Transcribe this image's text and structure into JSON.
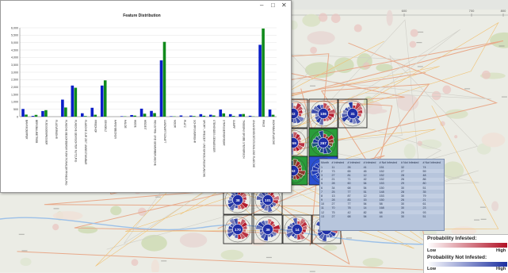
{
  "window": {
    "minimize": "–",
    "maximize": "□",
    "close": "✕"
  },
  "chart_data": {
    "type": "bar",
    "title": "Feature Distribution",
    "ylim": [
      0,
      6000
    ],
    "yticks": [
      "0",
      "500",
      "1,000",
      "1,500",
      "2,000",
      "2,500",
      "3,000",
      "3,500",
      "4,000",
      "4,500",
      "5,000",
      "5,500",
      "6,000"
    ],
    "categories": [
      "BAHNKOERPER",
      "BERGBAUBETRIEB",
      "FLIESSGEWAESSER",
      "FLUGVERKEHR",
      "FLAECHE BESONDERER FUNKTIONALER PRAEGUNG",
      "FLAECHE GEMISCHTER NUTZUNG",
      "FLAECHE ZUR ZEIT UNBESTIMMBAR",
      "FRIEDHOF",
      "GEHOELZ",
      "HAFENBECKEN",
      "HALDE",
      "HEIDE",
      "HEIDEIT",
      "INDUSTRIE- UND GEWERBEFLAECHE",
      "LANDWIRTSCHAFT",
      "MOOR",
      "PLATZ",
      "SCHIFFSVERKEHR",
      "SPORT-, FREIZEIT- UND ERHOLUNGSFLAECHE",
      "STEHENDES GEWAESSER",
      "STRASSENVERKEHR",
      "SUMPF",
      "TAGEBAU GRUBE STEINBRUCH",
      "UNLAND/VEGETATIONSLOSE FLAECHE",
      "WALD",
      "WOHNBAUFLAECHE"
    ],
    "series": [
      {
        "values": [
          520,
          50,
          380,
          0,
          1150,
          2100,
          230,
          600,
          2100,
          0,
          30,
          110,
          540,
          390,
          3800,
          30,
          80,
          70,
          170,
          130,
          480,
          170,
          170,
          60,
          4850,
          480
        ]
      },
      {
        "values": [
          140,
          120,
          440,
          0,
          620,
          1950,
          40,
          130,
          2450,
          0,
          20,
          70,
          200,
          240,
          5050,
          20,
          0,
          40,
          60,
          80,
          220,
          50,
          180,
          20,
          5950,
          130
        ]
      }
    ],
    "colors": [
      "#0a1ec8",
      "#108a1c"
    ]
  },
  "map": {
    "scale_labels": [
      "600",
      "700",
      "800"
    ],
    "markers": [
      {
        "label": "32"
      },
      {
        "label": "106"
      },
      {
        "label": "31"
      },
      {
        "label": "269"
      },
      {
        "label": "267"
      },
      {
        "label": "52"
      },
      {
        "label": "2"
      },
      {
        "label": "38"
      },
      {
        "label": "101"
      },
      {
        "label": "170"
      },
      {
        "label": "39"
      },
      {
        "label": "14"
      },
      {
        "label": "40"
      }
    ]
  },
  "info_table": {
    "headers": [
      "Month",
      "# Infested",
      "# Infested",
      "# Infested",
      "# Not Infested",
      "# Not Infested",
      "# Not Infested"
    ],
    "rows": [
      [
        "1",
        "11",
        "26",
        "41",
        "151",
        "32",
        "74"
      ],
      [
        "2",
        "73",
        "65",
        "45",
        "152",
        "27",
        "59"
      ],
      [
        "3",
        "27",
        "81",
        "12",
        "152",
        "28",
        "48"
      ],
      [
        "4",
        "21",
        "71",
        "42",
        "152",
        "26",
        "86"
      ],
      [
        "5",
        "28",
        "60",
        "54",
        "153",
        "29",
        "80"
      ],
      [
        "6",
        "34",
        "68",
        "54",
        "150",
        "30",
        "51"
      ],
      [
        "7",
        "25",
        "77",
        "51",
        "148",
        "28",
        "35"
      ],
      [
        "8",
        "13",
        "87",
        "12",
        "153",
        "30",
        "79"
      ],
      [
        "9",
        "28",
        "83",
        "15",
        "150",
        "26",
        "21"
      ],
      [
        "10",
        "27",
        "77",
        "54",
        "58",
        "30",
        "61"
      ],
      [
        "11",
        "70",
        "78",
        "14",
        "168",
        "30",
        "23"
      ],
      [
        "12",
        "75",
        "42",
        "82",
        "68",
        "26",
        "93"
      ],
      [
        "13",
        "27",
        "68",
        "54",
        "44",
        "30",
        "51"
      ]
    ]
  },
  "legend": {
    "infested_title": "Probability Infested:",
    "not_infested_title": "Probability Not Infested:",
    "low": "Low",
    "high": "High",
    "infested_color": "#b11226",
    "not_infested_color": "#1b2fa0"
  }
}
